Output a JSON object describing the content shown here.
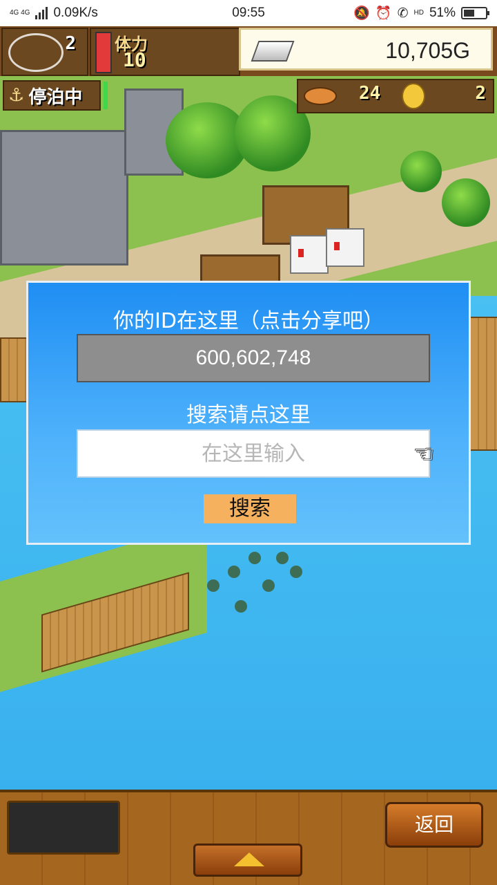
{
  "status_bar": {
    "network": "4G 4G",
    "speed": "0.09K/s",
    "time": "09:55",
    "hd": "HD",
    "battery": "51%",
    "battery_level": 0.51
  },
  "hud": {
    "level": "2",
    "stamina_label": "体力",
    "stamina": "10",
    "stamina_level": 1.0,
    "gold": "10,705G",
    "status": "停泊中",
    "fish_count": "24",
    "coins": "2"
  },
  "dialog": {
    "title": "你的ID在这里（点击分享吧）",
    "id": "600,602,748",
    "search_label": "搜索请点这里",
    "search_placeholder": "在这里输入",
    "search_button": "搜索"
  },
  "bottom": {
    "back": "返回"
  },
  "colors": {
    "dialog_top": "#1f8ef3",
    "dialog_bottom": "#63c1fb",
    "search_button": "#f5b15e",
    "sea": "#39b1ee"
  },
  "icons": {
    "level": "gamepad-icon",
    "gold": "silver-bar-icon",
    "status": "anchor-icon",
    "fish": "fish-icon",
    "coin": "coin-icon",
    "pointer": "hand-pointer-icon",
    "menu": "triangle-up-icon"
  }
}
